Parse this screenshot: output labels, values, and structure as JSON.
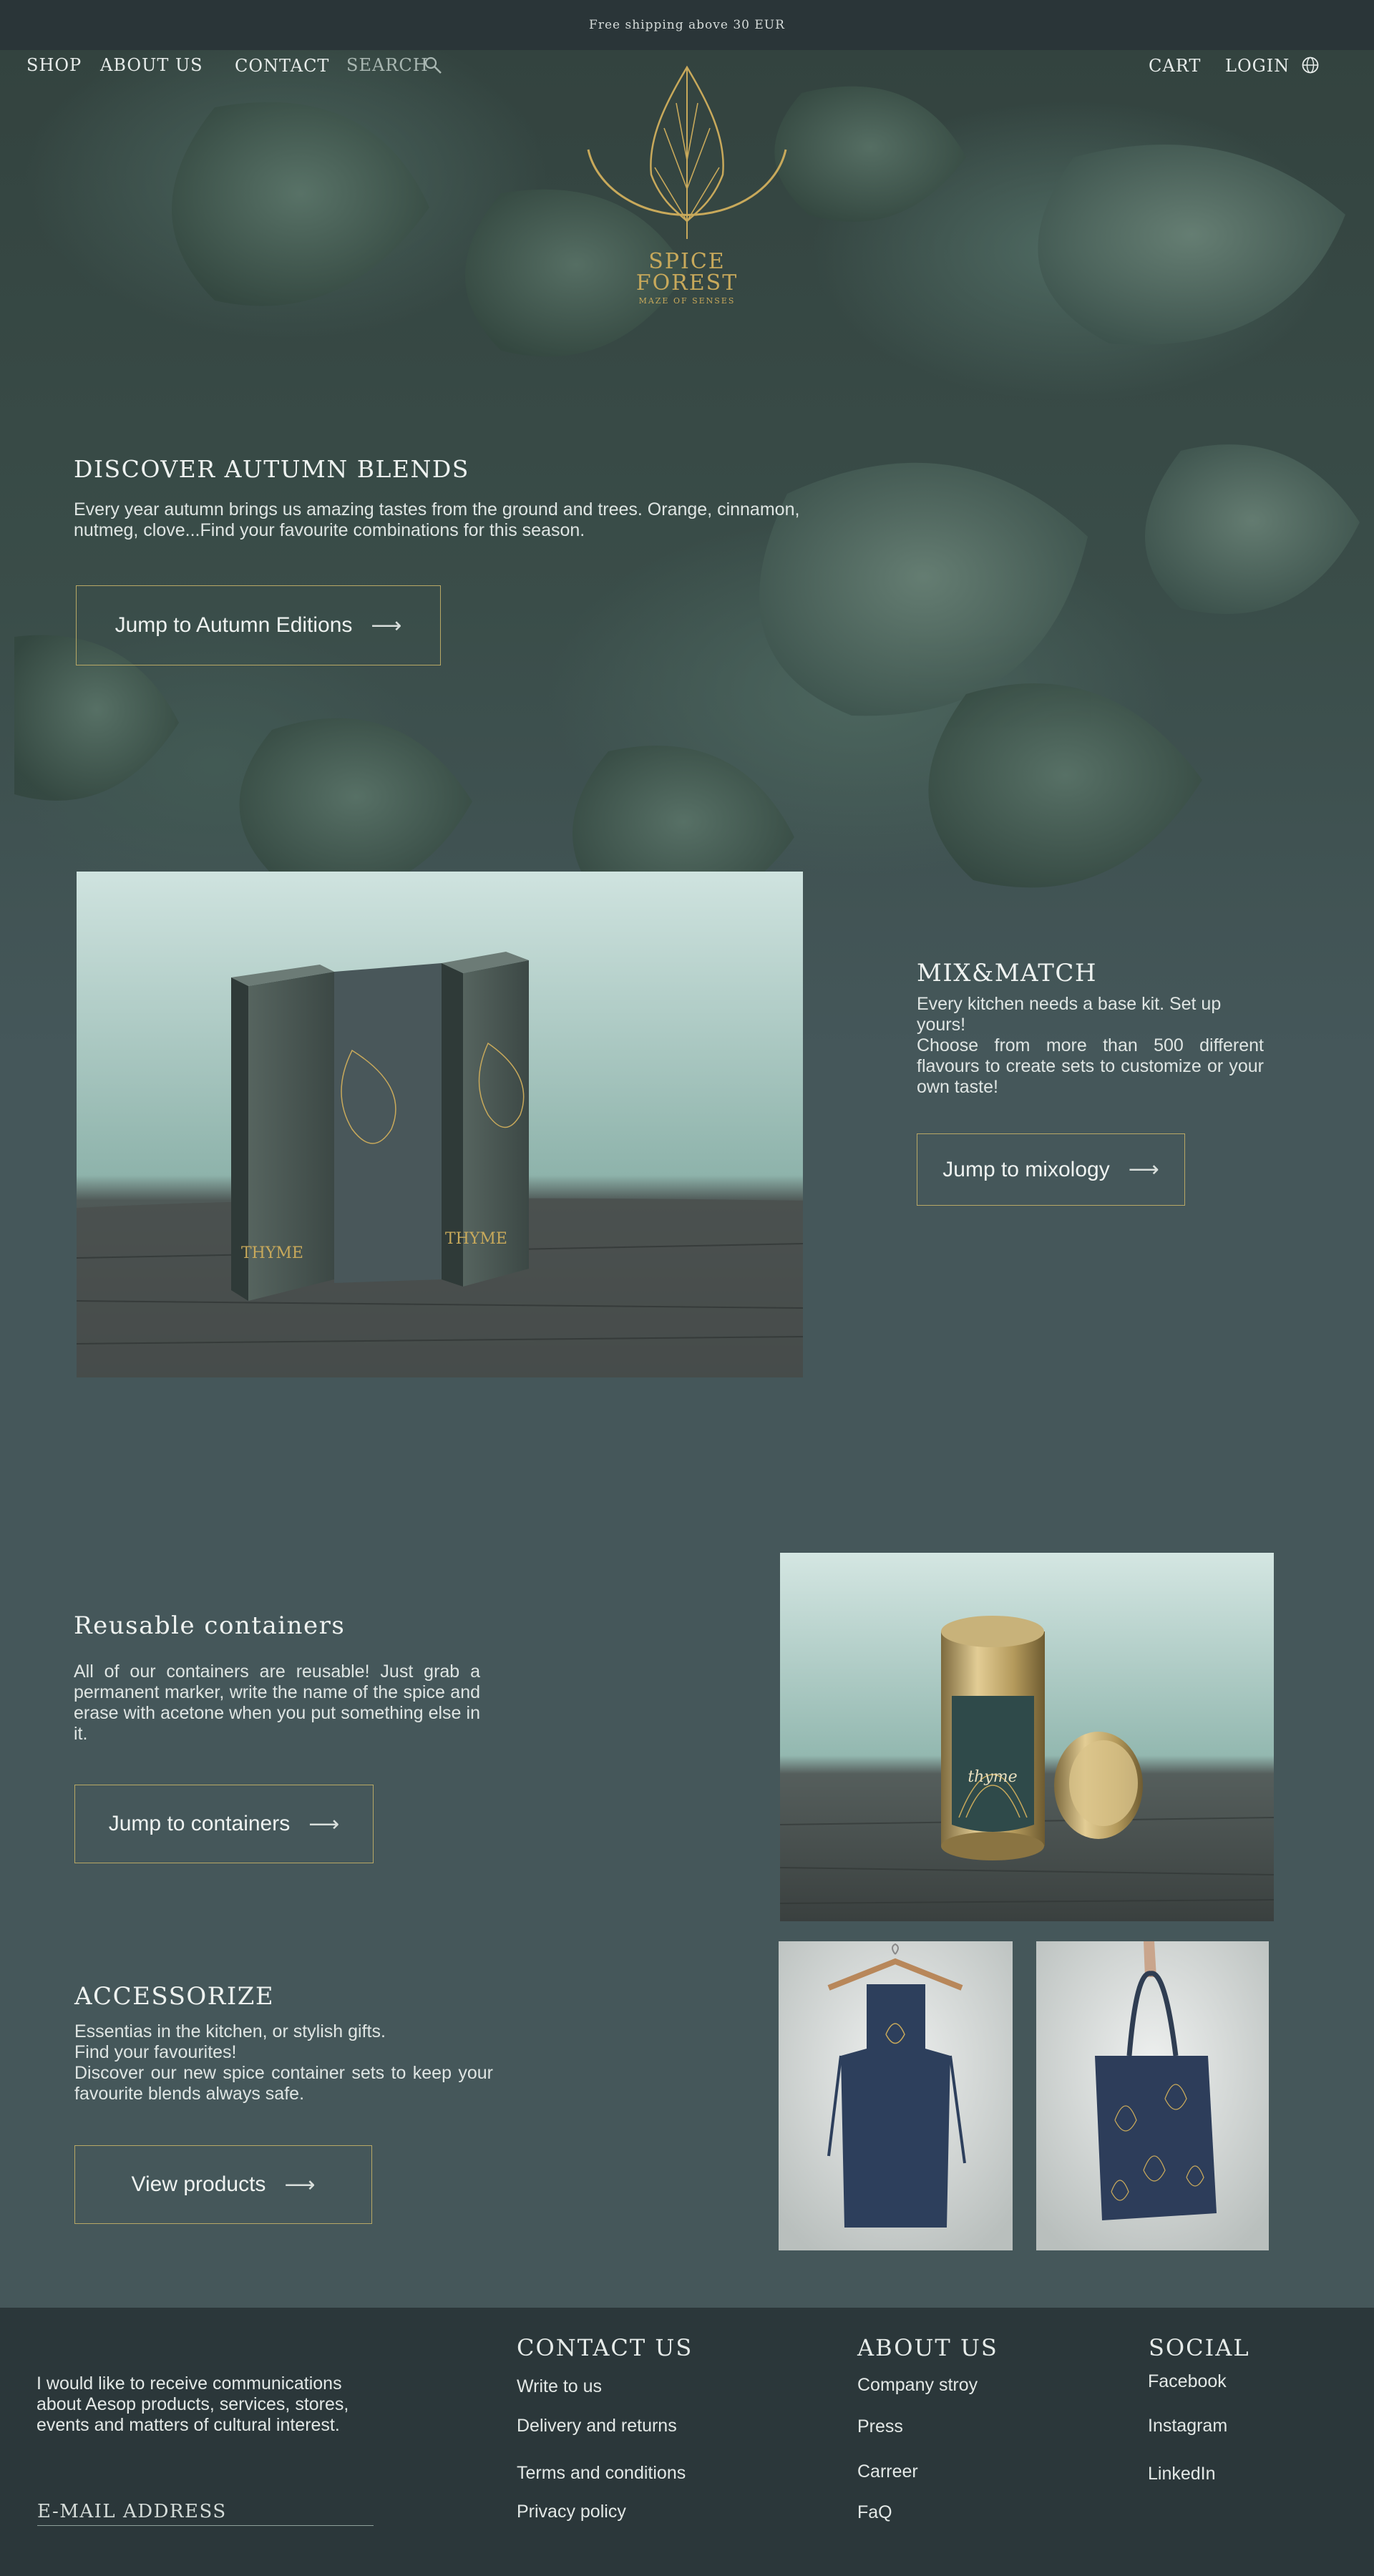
{
  "announcement": "Free shipping above 30 EUR",
  "nav": {
    "shop": "SHOP",
    "about": "ABOUT US",
    "contact": "CONTACT",
    "search": "SEARCH",
    "cart": "CART",
    "login": "LOGIN"
  },
  "logo": {
    "line1": "SPICE",
    "line2": "FOREST",
    "tagline": "MAZE OF SENSES"
  },
  "hero": {
    "title": "DISCOVER AUTUMN BLENDS",
    "text": "Every year autumn brings us amazing tastes from the ground and trees. Orange, cinnamon, nutmeg, clove...Find your favourite combinations for this season.",
    "cta": "Jump to Autumn Editions"
  },
  "mix": {
    "title": "MIX&MATCH",
    "text1": "Every kitchen needs a base kit. Set up yours!",
    "text2": "Choose from more than 500 different flavours to create sets to customize or your own taste!",
    "cta": "Jump to mixology",
    "box_label": "THYME"
  },
  "containers": {
    "title": "Reusable containers",
    "text": "All of our containers are reusable! Just grab a permanent marker, write the name of the spice and erase with acetone when you put something else in it.",
    "cta": "Jump to containers",
    "tin_label": "thyme"
  },
  "accessorize": {
    "title": "ACCESSORIZE",
    "line1": "Essentias in the kitchen, or stylish gifts.",
    "line2": "Find your favourites!",
    "line3": "Discover our new spice container sets to keep your favourite blends always safe.",
    "cta": "View products"
  },
  "footer": {
    "newsletter": "I would like to receive communications about Aesop products, services, stores, events and matters of cultural interest.",
    "email_placeholder": "E-MAIL ADDRESS",
    "contact_title": "CONTACT US",
    "contact_links": [
      "Write to us",
      "Delivery and returns",
      "Terms and conditions",
      "Privacy policy"
    ],
    "about_title": "ABOUT US",
    "about_links": [
      "Company stroy",
      "Press",
      "Carreer",
      "FaQ"
    ],
    "social_title": "SOCIAL",
    "social_links": [
      "Facebook",
      "Instagram",
      "LinkedIn"
    ]
  },
  "colors": {
    "accent_gold": "#c8a95b",
    "page_bg": "#45575a",
    "footer_bg": "#2b373a",
    "button_border": "#b8a865"
  }
}
